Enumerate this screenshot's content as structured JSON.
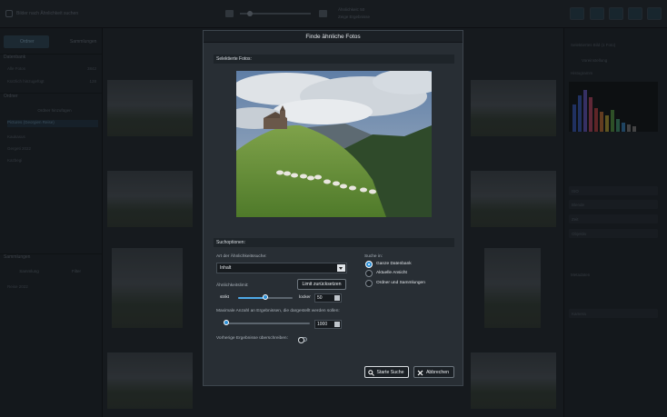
{
  "app": {
    "top_title": "Bilder nach Ähnlichkeit suchen",
    "top_right_line1": "Ähnlichkeit: 50",
    "top_right_line2": "Zeige Ergebnisse"
  },
  "left_panel": {
    "tab_active": "Ordner",
    "tab_other": "Sammlungen",
    "sections": [
      {
        "label": "Datenbank"
      },
      {
        "label": "Ordner"
      },
      {
        "label": "Sammlungen"
      }
    ],
    "rows": [
      {
        "label": "Alle Fotos",
        "count": "3842"
      },
      {
        "label": "Kürzlich hinzugefügt",
        "count": "128"
      },
      {
        "label": "Ordner hinzufügen",
        "count": ""
      },
      {
        "label": "Pictures (Georgien Reise)",
        "count": ""
      },
      {
        "label": "Kaukasus",
        "count": ""
      },
      {
        "label": "Gergeti 2022",
        "count": ""
      },
      {
        "label": "Kazbegi",
        "count": ""
      }
    ],
    "buttons": {
      "new": "Sammlung",
      "add": "Filter"
    },
    "footer_item": "Reise 2022"
  },
  "right_panel": {
    "top_label": "Selektiertes Bild (1 Foto)",
    "sub_label": "Voreinstellung",
    "histogram_label": "Histogramm",
    "metadata_label": "Metadaten",
    "rows": [
      "ISO",
      "Blende",
      "Zeit",
      "Objektiv",
      "Kamera"
    ]
  },
  "dialog": {
    "title": "Finde ähnliche Fotos",
    "selected_label": "Selektierte Fotos:",
    "options_label": "Suchoptionen:",
    "search_type_label": "Art der Ähnlichkeitssuche:",
    "search_type_value": "Inhalt",
    "similarity_label": "Ähnlichkeitslimit:",
    "reset_button": "Limit zurücksetzen",
    "strict_label": "strikt",
    "loose_label": "locker",
    "similarity_value": "50",
    "similarity_fraction": 0.5,
    "max_results_label": "Maximale Anzahl an Ergebnissen, die dargestellt werden sollen:",
    "max_results_value": "1000",
    "max_results_fraction": 0.0,
    "overwrite_label": "Vorherige Ergebnisse überschreiben:",
    "overwrite_on": false,
    "search_in_label": "Suche in:",
    "search_in_options": [
      "Ganze Datenbank",
      "Aktuelle Ansicht",
      "Ordner und Sammlungen"
    ],
    "search_in_selected": 0,
    "start_button": "Starte Suche",
    "cancel_button": "Abbrechen"
  },
  "colors": {
    "accent": "#2c8fd6",
    "dialog_bg": "#282e34",
    "title_bg": "#1b2025"
  }
}
